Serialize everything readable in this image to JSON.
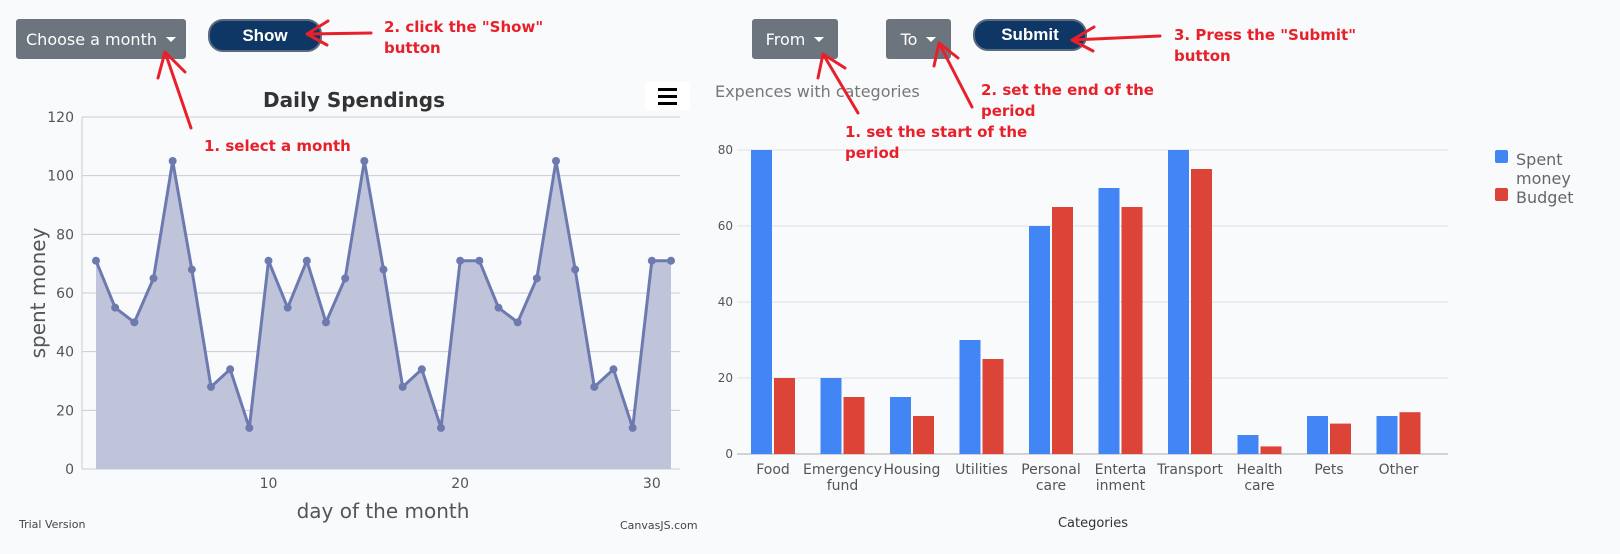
{
  "controls": {
    "month_dropdown": "Choose a month",
    "show_button": "Show",
    "from_dropdown": "From",
    "to_dropdown": "To",
    "submit_button": "Submit"
  },
  "annotations": {
    "select_month": "1. select a month",
    "click_show": "2. click the \"Show\"",
    "click_show_2": "button",
    "set_start": "1. set the start of the",
    "set_start_2": "period",
    "set_end": "2. set the end of the",
    "set_end_2": "period",
    "press_submit": "3. Press the \"Submit\"",
    "press_submit_2": "button"
  },
  "footer": {
    "trial": "Trial Version",
    "credit": "CanvasJS.com"
  },
  "colors": {
    "spent": "#4285f4",
    "budget": "#db4437",
    "area_fill": "#bfc4da",
    "area_line": "#6c7ab0",
    "annotation": "#e8202a",
    "button_dark": "#0e3766",
    "dropdown_gray": "#6c757d"
  },
  "chart_data": [
    {
      "type": "area",
      "title": "Daily Spendings",
      "xlabel": "day of the month",
      "ylabel": "spent money",
      "x": [
        1,
        2,
        3,
        4,
        5,
        6,
        7,
        8,
        9,
        10,
        11,
        12,
        13,
        14,
        15,
        16,
        17,
        18,
        19,
        20,
        21,
        22,
        23,
        24,
        25,
        26,
        27,
        28,
        29,
        30,
        31
      ],
      "values": [
        71,
        55,
        50,
        65,
        105,
        68,
        28,
        34,
        14,
        71,
        55,
        71,
        50,
        65,
        105,
        68,
        28,
        34,
        14,
        71,
        71,
        55,
        50,
        65,
        105,
        68,
        28,
        34,
        14,
        71,
        71
      ],
      "xticks": [
        "10",
        "20",
        "30"
      ],
      "yticks": [
        "0",
        "20",
        "40",
        "60",
        "80",
        "100",
        "120"
      ],
      "ylim": [
        0,
        120
      ],
      "grid": true
    },
    {
      "type": "bar",
      "title": "Expences with categories",
      "xlabel": "Categories",
      "ylabel": "",
      "categories": [
        "Food",
        "Emergency fund",
        "Housing",
        "Utilities",
        "Personal care",
        "Entertainment",
        "Transport",
        "Health care",
        "Pets",
        "Other"
      ],
      "category_lines": [
        [
          "Food"
        ],
        [
          "Emergency",
          "fund"
        ],
        [
          "Housing"
        ],
        [
          "Utilities"
        ],
        [
          "Personal",
          "care"
        ],
        [
          "Enterta",
          "inment"
        ],
        [
          "Transport"
        ],
        [
          "Health",
          "care"
        ],
        [
          "Pets"
        ],
        [
          "Other"
        ]
      ],
      "series": [
        {
          "name": "Spent money",
          "values": [
            80,
            20,
            15,
            30,
            60,
            70,
            80,
            5,
            10,
            10
          ]
        },
        {
          "name": "Budget",
          "values": [
            20,
            15,
            10,
            25,
            65,
            65,
            75,
            2,
            8,
            11
          ]
        }
      ],
      "yticks": [
        "0",
        "20",
        "40",
        "60",
        "80"
      ],
      "ylim": [
        0,
        85
      ],
      "legend": "right",
      "grid": true
    }
  ]
}
